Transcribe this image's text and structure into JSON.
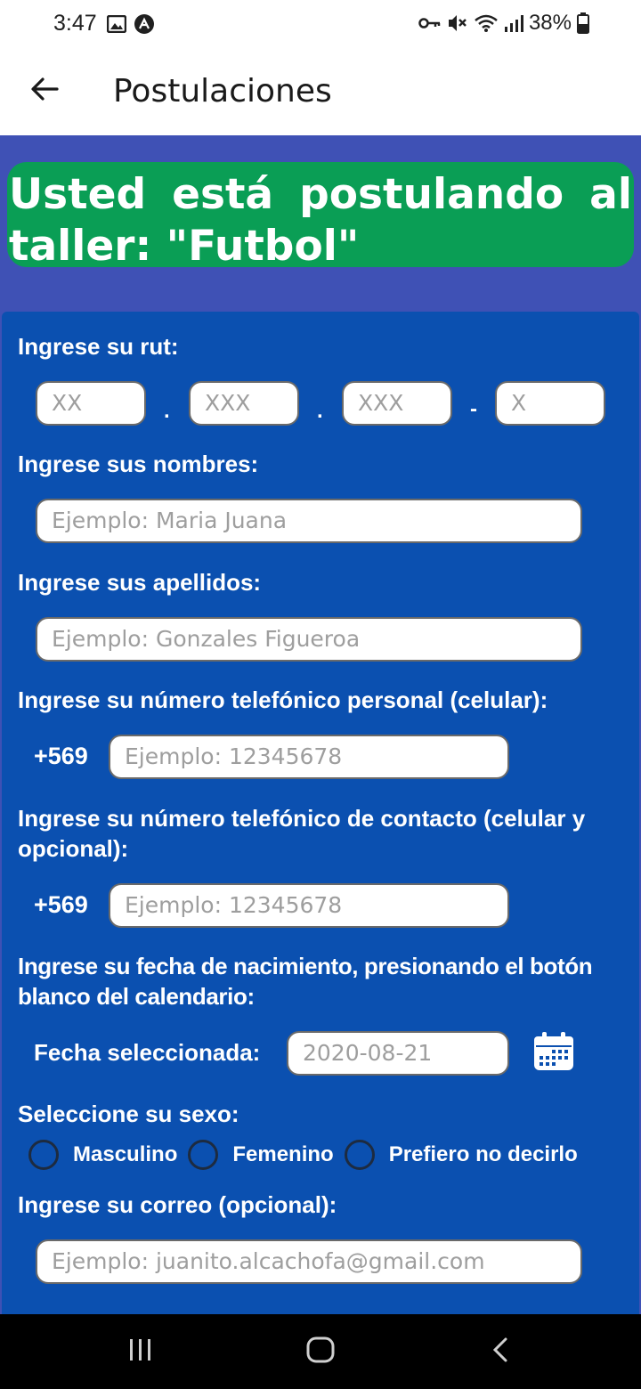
{
  "status_bar": {
    "time": "3:47",
    "battery": "38%",
    "left_icons": [
      "image-icon",
      "app-notification-icon"
    ],
    "right_icons": [
      "vpn-key-icon",
      "mute-icon",
      "wifi-icon",
      "signal-icon",
      "battery-icon"
    ]
  },
  "app_bar": {
    "title": "Postulaciones",
    "back_icon": "arrow-left-icon"
  },
  "banner": {
    "text": "Usted está postulando al taller: \"Futbol\""
  },
  "form": {
    "rut": {
      "label": "Ingrese su rut:",
      "placeholders": [
        "XX",
        "XXX",
        "XXX",
        "X"
      ],
      "separators": [
        ".",
        ".",
        "-"
      ]
    },
    "nombres": {
      "label": "Ingrese sus nombres:",
      "placeholder": "Ejemplo: Maria Juana"
    },
    "apellidos": {
      "label": "Ingrese sus apellidos:",
      "placeholder": "Ejemplo: Gonzales Figueroa"
    },
    "telefono_personal": {
      "label": "Ingrese su número telefónico personal (celular):",
      "prefix": "+569",
      "placeholder": "Ejemplo: 12345678"
    },
    "telefono_contacto": {
      "label": "Ingrese su número telefónico de contacto (celular y opcional):",
      "prefix": "+569",
      "placeholder": "Ejemplo: 12345678"
    },
    "fecha_nacimiento": {
      "label": "Ingrese su fecha de nacimiento, presionando el botón blanco del calendario:",
      "selected_label": "Fecha seleccionada:",
      "placeholder": "2020-08-21",
      "calendar_icon": "calendar-icon"
    },
    "sexo": {
      "label": "Seleccione su sexo:",
      "options": [
        "Masculino",
        "Femenino",
        "Prefiero no decirlo"
      ]
    },
    "correo": {
      "label": "Ingrese su correo (opcional):",
      "placeholder": "Ejemplo: juanito.alcachofa@gmail.com"
    }
  },
  "colors": {
    "app_background": "#3f51b5",
    "form_background": "#0b50b0",
    "banner": "#0a9e55",
    "text_on_dark": "#ffffff",
    "placeholder": "#9e9e9e"
  },
  "nav_bar": {
    "icons": [
      "recent-apps-icon",
      "home-icon",
      "back-nav-icon"
    ]
  }
}
